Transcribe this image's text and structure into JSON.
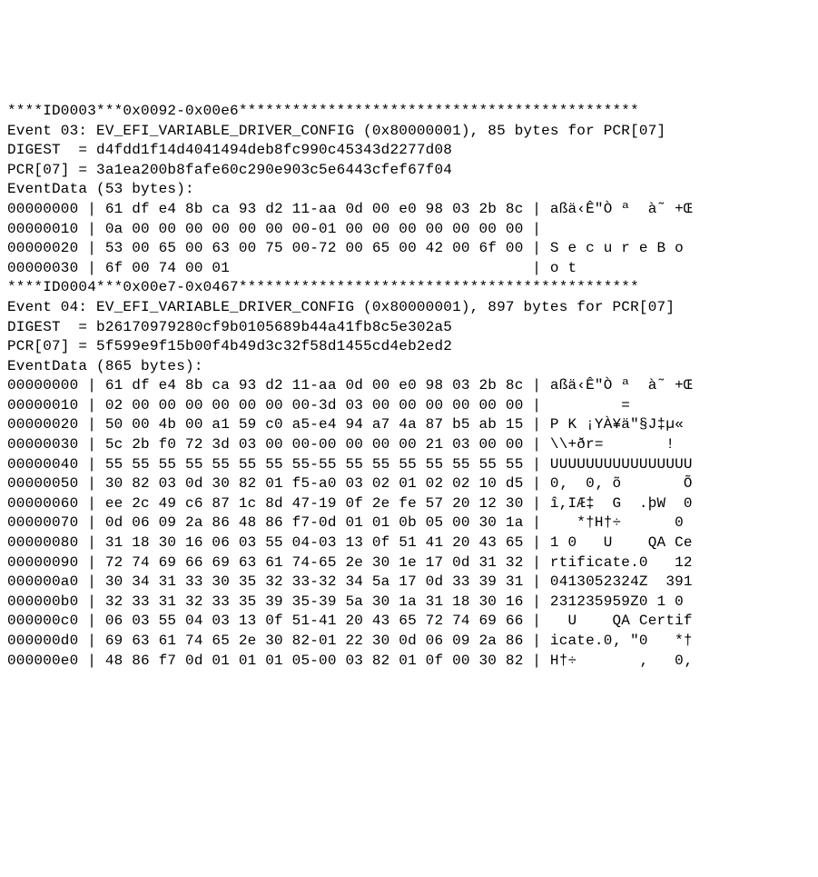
{
  "lines": [
    "****ID0003***0x0092-0x00e6*********************************************",
    "Event 03: EV_EFI_VARIABLE_DRIVER_CONFIG (0x80000001), 85 bytes for PCR[07]",
    "DIGEST  = d4fdd1f14d4041494deb8fc990c45343d2277d08",
    "PCR[07] = 3a1ea200b8fafe60c290e903c5e6443cfef67f04",
    "EventData (53 bytes):",
    "00000000 | 61 df e4 8b ca 93 d2 11-aa 0d 00 e0 98 03 2b 8c | aßä‹Ê\"Ò ª  à˜ +Œ",
    "00000010 | 0a 00 00 00 00 00 00 00-01 00 00 00 00 00 00 00 |",
    "00000020 | 53 00 65 00 63 00 75 00-72 00 65 00 42 00 6f 00 | S e c u r e B o",
    "00000030 | 6f 00 74 00 01                                  | o t",
    "****ID0004***0x00e7-0x0467*********************************************",
    "Event 04: EV_EFI_VARIABLE_DRIVER_CONFIG (0x80000001), 897 bytes for PCR[07]",
    "DIGEST  = b26170979280cf9b0105689b44a41fb8c5e302a5",
    "PCR[07] = 5f599e9f15b00f4b49d3c32f58d1455cd4eb2ed2",
    "EventData (865 bytes):",
    "00000000 | 61 df e4 8b ca 93 d2 11-aa 0d 00 e0 98 03 2b 8c | aßä‹Ê\"Ò ª  à˜ +Œ",
    "00000010 | 02 00 00 00 00 00 00 00-3d 03 00 00 00 00 00 00 |         =",
    "00000020 | 50 00 4b 00 a1 59 c0 a5-e4 94 a7 4a 87 b5 ab 15 | P K ¡YÀ¥ä\"§J‡µ«",
    "00000030 | 5c 2b f0 72 3d 03 00 00-00 00 00 00 21 03 00 00 | \\\\+ðr=       !",
    "00000040 | 55 55 55 55 55 55 55 55-55 55 55 55 55 55 55 55 | UUUUUUUUUUUUUUUU",
    "00000050 | 30 82 03 0d 30 82 01 f5-a0 03 02 01 02 02 10 d5 | 0‚  0‚ õ       Õ",
    "00000060 | ee 2c 49 c6 87 1c 8d 47-19 0f 2e fe 57 20 12 30 | î,IÆ‡  G  .þW  0",
    "00000070 | 0d 06 09 2a 86 48 86 f7-0d 01 01 0b 05 00 30 1a |    *†H†÷      0",
    "00000080 | 31 18 30 16 06 03 55 04-03 13 0f 51 41 20 43 65 | 1 0   U    QA Ce",
    "00000090 | 72 74 69 66 69 63 61 74-65 2e 30 1e 17 0d 31 32 | rtificate.0   12",
    "000000a0 | 30 34 31 33 30 35 32 33-32 34 5a 17 0d 33 39 31 | 0413052324Z  391",
    "000000b0 | 32 33 31 32 33 35 39 35-39 5a 30 1a 31 18 30 16 | 231235959Z0 1 0",
    "000000c0 | 06 03 55 04 03 13 0f 51-41 20 43 65 72 74 69 66 |   U    QA Certif",
    "000000d0 | 69 63 61 74 65 2e 30 82-01 22 30 0d 06 09 2a 86 | icate.0‚ \"0   *†",
    "000000e0 | 48 86 f7 0d 01 01 01 05-00 03 82 01 0f 00 30 82 | H†÷       ‚   0‚"
  ]
}
